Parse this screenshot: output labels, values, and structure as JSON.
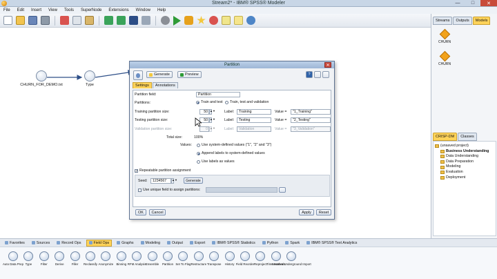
{
  "app": {
    "title": "Stream2* - IBM® SPSS® Modeler"
  },
  "menu": [
    "File",
    "Edit",
    "Insert",
    "View",
    "Tools",
    "SuperNode",
    "Extensions",
    "Window",
    "Help"
  ],
  "toolbar": {
    "icons": [
      "new-stream-icon",
      "open-icon",
      "save-icon",
      "print-icon",
      "cut-icon",
      "copy-icon",
      "paste-icon",
      "undo-icon",
      "redo-icon",
      "find-icon",
      "zoom-icon",
      "stop-icon",
      "run-icon",
      "run-selection-icon",
      "preview-icon",
      "supernode-icon",
      "note-icon",
      "annotation-icon",
      "help-icon"
    ]
  },
  "canvas": {
    "nodes": [
      {
        "id": "source",
        "label": "CHURN_FOR_DEMO.txt",
        "icon": "file-source-icon"
      },
      {
        "id": "type",
        "label": "Type",
        "icon": "type-node-icon"
      }
    ]
  },
  "managers": {
    "tabs": [
      "Streams",
      "Outputs",
      "Models"
    ],
    "active_tab": "Models",
    "models": [
      {
        "label": "CHURN"
      },
      {
        "label": "CHURN"
      }
    ]
  },
  "project": {
    "tabs": [
      "CRISP-DM",
      "Classes"
    ],
    "active_tab": "CRISP-DM",
    "root": "(unsaved project)",
    "items": [
      "Business Understanding",
      "Data Understanding",
      "Data Preparation",
      "Modeling",
      "Evaluation",
      "Deployment"
    ],
    "bold_item": "Business Understanding"
  },
  "palette": {
    "tabs": [
      "Favorites",
      "Sources",
      "Record Ops",
      "Field Ops",
      "Graphs",
      "Modeling",
      "Output",
      "Export",
      "IBM® SPSS® Statistics",
      "Python",
      "Spark",
      "IBM® SPSS® Text Analytics"
    ],
    "active_tab": "Field Ops",
    "nodes": [
      "Auto Data Prep",
      "Type",
      "Filter",
      "Derive",
      "Filler",
      "Reclassify",
      "Anonymize",
      "Binning",
      "RFM Analysis",
      "Ensemble",
      "Partition",
      "Set To Flag",
      "Restructure",
      "Transpose",
      "History",
      "Field Reorder",
      "Reproject",
      "Time Intervals",
      "Weather Underground Import"
    ]
  },
  "dialog": {
    "title": "Partition",
    "generate_label": "Generate",
    "preview_label": "Preview",
    "tabs": [
      "Settings",
      "Annotations"
    ],
    "active_tab": "Settings",
    "partition_field_label": "Partition field:",
    "partition_field_value": "Partition",
    "partitions_label": "Partitions:",
    "partitions_options": [
      "Train and test",
      "Train, test and validation"
    ],
    "partitions_selected": "Train and test",
    "training_label": "Training partition size:",
    "training_value": "50",
    "training_label_field": "Training",
    "training_value_field": "\"1_Training\"",
    "testing_label": "Testing partition size:",
    "testing_value": "50",
    "testing_label_field": "Testing",
    "testing_value_field": "\"2_Testing\"",
    "validation_label": "Validation partition size:",
    "validation_value": "0",
    "validation_label_field": "Validation",
    "validation_value_field": "\"3_Validation\"",
    "label_caption": "Label:",
    "value_caption": "Value =",
    "total_size_label": "Total size:",
    "total_size_value": "100%",
    "values_label": "Values:",
    "values_options": [
      "Use system-defined values (\"1\", \"2\" and \"3\")",
      "Append labels to system-defined values",
      "Use labels as values"
    ],
    "values_selected": "Append labels to system-defined values",
    "repeatable_label": "Repeatable partition assignment",
    "repeatable_checked": true,
    "seed_label": "Seed:",
    "seed_value": "1234567",
    "seed_generate_label": "Generate",
    "unique_field_label": "Use unique field to assign partitions:",
    "unique_field_checked": false,
    "ok_label": "OK",
    "cancel_label": "Cancel",
    "apply_label": "Apply",
    "reset_label": "Reset"
  }
}
